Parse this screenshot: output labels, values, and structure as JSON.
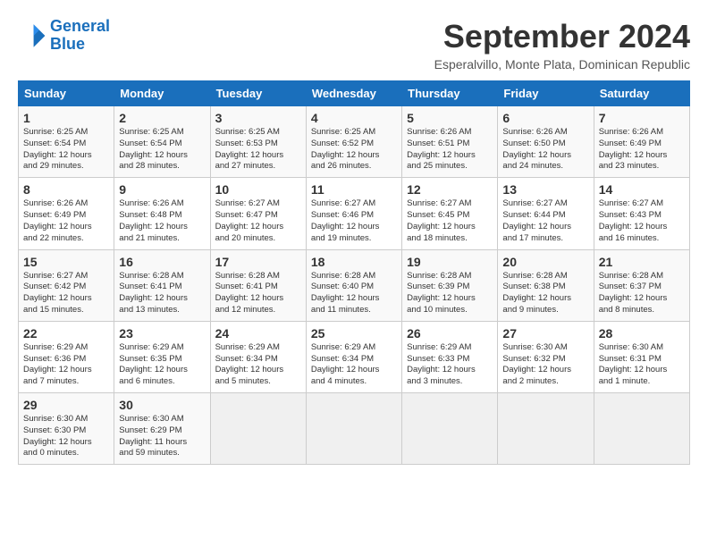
{
  "header": {
    "logo_line1": "General",
    "logo_line2": "Blue",
    "title": "September 2024",
    "subtitle": "Esperalvillo, Monte Plata, Dominican Republic"
  },
  "weekdays": [
    "Sunday",
    "Monday",
    "Tuesday",
    "Wednesday",
    "Thursday",
    "Friday",
    "Saturday"
  ],
  "weeks": [
    [
      {
        "day": "1",
        "info": "Sunrise: 6:25 AM\nSunset: 6:54 PM\nDaylight: 12 hours\nand 29 minutes."
      },
      {
        "day": "2",
        "info": "Sunrise: 6:25 AM\nSunset: 6:54 PM\nDaylight: 12 hours\nand 28 minutes."
      },
      {
        "day": "3",
        "info": "Sunrise: 6:25 AM\nSunset: 6:53 PM\nDaylight: 12 hours\nand 27 minutes."
      },
      {
        "day": "4",
        "info": "Sunrise: 6:25 AM\nSunset: 6:52 PM\nDaylight: 12 hours\nand 26 minutes."
      },
      {
        "day": "5",
        "info": "Sunrise: 6:26 AM\nSunset: 6:51 PM\nDaylight: 12 hours\nand 25 minutes."
      },
      {
        "day": "6",
        "info": "Sunrise: 6:26 AM\nSunset: 6:50 PM\nDaylight: 12 hours\nand 24 minutes."
      },
      {
        "day": "7",
        "info": "Sunrise: 6:26 AM\nSunset: 6:49 PM\nDaylight: 12 hours\nand 23 minutes."
      }
    ],
    [
      {
        "day": "8",
        "info": "Sunrise: 6:26 AM\nSunset: 6:49 PM\nDaylight: 12 hours\nand 22 minutes."
      },
      {
        "day": "9",
        "info": "Sunrise: 6:26 AM\nSunset: 6:48 PM\nDaylight: 12 hours\nand 21 minutes."
      },
      {
        "day": "10",
        "info": "Sunrise: 6:27 AM\nSunset: 6:47 PM\nDaylight: 12 hours\nand 20 minutes."
      },
      {
        "day": "11",
        "info": "Sunrise: 6:27 AM\nSunset: 6:46 PM\nDaylight: 12 hours\nand 19 minutes."
      },
      {
        "day": "12",
        "info": "Sunrise: 6:27 AM\nSunset: 6:45 PM\nDaylight: 12 hours\nand 18 minutes."
      },
      {
        "day": "13",
        "info": "Sunrise: 6:27 AM\nSunset: 6:44 PM\nDaylight: 12 hours\nand 17 minutes."
      },
      {
        "day": "14",
        "info": "Sunrise: 6:27 AM\nSunset: 6:43 PM\nDaylight: 12 hours\nand 16 minutes."
      }
    ],
    [
      {
        "day": "15",
        "info": "Sunrise: 6:27 AM\nSunset: 6:42 PM\nDaylight: 12 hours\nand 15 minutes."
      },
      {
        "day": "16",
        "info": "Sunrise: 6:28 AM\nSunset: 6:41 PM\nDaylight: 12 hours\nand 13 minutes."
      },
      {
        "day": "17",
        "info": "Sunrise: 6:28 AM\nSunset: 6:41 PM\nDaylight: 12 hours\nand 12 minutes."
      },
      {
        "day": "18",
        "info": "Sunrise: 6:28 AM\nSunset: 6:40 PM\nDaylight: 12 hours\nand 11 minutes."
      },
      {
        "day": "19",
        "info": "Sunrise: 6:28 AM\nSunset: 6:39 PM\nDaylight: 12 hours\nand 10 minutes."
      },
      {
        "day": "20",
        "info": "Sunrise: 6:28 AM\nSunset: 6:38 PM\nDaylight: 12 hours\nand 9 minutes."
      },
      {
        "day": "21",
        "info": "Sunrise: 6:28 AM\nSunset: 6:37 PM\nDaylight: 12 hours\nand 8 minutes."
      }
    ],
    [
      {
        "day": "22",
        "info": "Sunrise: 6:29 AM\nSunset: 6:36 PM\nDaylight: 12 hours\nand 7 minutes."
      },
      {
        "day": "23",
        "info": "Sunrise: 6:29 AM\nSunset: 6:35 PM\nDaylight: 12 hours\nand 6 minutes."
      },
      {
        "day": "24",
        "info": "Sunrise: 6:29 AM\nSunset: 6:34 PM\nDaylight: 12 hours\nand 5 minutes."
      },
      {
        "day": "25",
        "info": "Sunrise: 6:29 AM\nSunset: 6:34 PM\nDaylight: 12 hours\nand 4 minutes."
      },
      {
        "day": "26",
        "info": "Sunrise: 6:29 AM\nSunset: 6:33 PM\nDaylight: 12 hours\nand 3 minutes."
      },
      {
        "day": "27",
        "info": "Sunrise: 6:30 AM\nSunset: 6:32 PM\nDaylight: 12 hours\nand 2 minutes."
      },
      {
        "day": "28",
        "info": "Sunrise: 6:30 AM\nSunset: 6:31 PM\nDaylight: 12 hours\nand 1 minute."
      }
    ],
    [
      {
        "day": "29",
        "info": "Sunrise: 6:30 AM\nSunset: 6:30 PM\nDaylight: 12 hours\nand 0 minutes."
      },
      {
        "day": "30",
        "info": "Sunrise: 6:30 AM\nSunset: 6:29 PM\nDaylight: 11 hours\nand 59 minutes."
      },
      {
        "day": "",
        "info": ""
      },
      {
        "day": "",
        "info": ""
      },
      {
        "day": "",
        "info": ""
      },
      {
        "day": "",
        "info": ""
      },
      {
        "day": "",
        "info": ""
      }
    ]
  ]
}
